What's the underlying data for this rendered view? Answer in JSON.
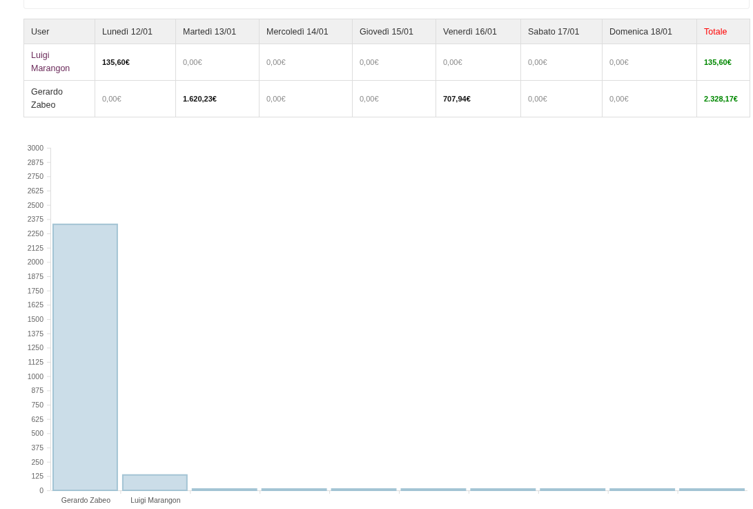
{
  "table": {
    "columns": [
      {
        "label": "User",
        "kind": "user"
      },
      {
        "label": "Lunedì 12/01",
        "kind": "day"
      },
      {
        "label": "Martedì 13/01",
        "kind": "day"
      },
      {
        "label": "Mercoledì 14/01",
        "kind": "day"
      },
      {
        "label": "Giovedì 15/01",
        "kind": "day"
      },
      {
        "label": "Venerdì 16/01",
        "kind": "day"
      },
      {
        "label": "Sabato 17/01",
        "kind": "day"
      },
      {
        "label": "Domenica 18/01",
        "kind": "day"
      },
      {
        "label": "Totale",
        "kind": "total"
      }
    ],
    "rows": [
      {
        "user": {
          "text": "Luigi Marangon",
          "visited": true
        },
        "values": [
          {
            "text": "135,60€",
            "emphasized": true
          },
          {
            "text": "0,00€",
            "emphasized": false
          },
          {
            "text": "0,00€",
            "emphasized": false
          },
          {
            "text": "0,00€",
            "emphasized": false
          },
          {
            "text": "0,00€",
            "emphasized": false
          },
          {
            "text": "0,00€",
            "emphasized": false
          },
          {
            "text": "0,00€",
            "emphasized": false
          }
        ],
        "total": "135,60€"
      },
      {
        "user": {
          "text": "Gerardo Zabeo",
          "visited": false
        },
        "values": [
          {
            "text": "0,00€",
            "emphasized": false
          },
          {
            "text": "1.620,23€",
            "emphasized": true
          },
          {
            "text": "0,00€",
            "emphasized": false
          },
          {
            "text": "0,00€",
            "emphasized": false
          },
          {
            "text": "707,94€",
            "emphasized": true
          },
          {
            "text": "0,00€",
            "emphasized": false
          },
          {
            "text": "0,00€",
            "emphasized": false
          }
        ],
        "total": "2.328,17€"
      }
    ]
  },
  "chart": {
    "chart_data": {
      "type": "bar",
      "categories": [
        "Gerardo Zabeo",
        "Luigi Marangon",
        null,
        null,
        null,
        null,
        null,
        null,
        null,
        null
      ],
      "series": [
        {
          "color": "#cbdde8",
          "values": [
            2330,
            135,
            0,
            0,
            0,
            0,
            0,
            0,
            0,
            0
          ]
        }
      ],
      "ylim": [
        0,
        3000
      ],
      "yticks": [
        0,
        125,
        250,
        375,
        500,
        625,
        750,
        875,
        1000,
        1125,
        1250,
        1375,
        1500,
        1625,
        1750,
        1875,
        2000,
        2125,
        2250,
        2375,
        2500,
        2625,
        2750,
        2875,
        3000
      ]
    }
  }
}
